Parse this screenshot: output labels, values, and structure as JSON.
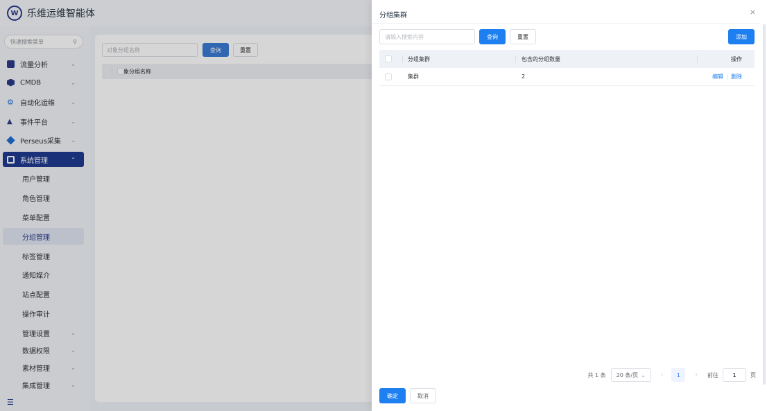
{
  "app": {
    "title": "乐维运维智能体",
    "logo_text": "W"
  },
  "sidebar": {
    "search_placeholder": "快速搜索菜单",
    "items": [
      {
        "label": "流量分析",
        "icon": "chart-icon",
        "color": "#2a3a8a"
      },
      {
        "label": "CMDB",
        "icon": "cube-icon",
        "color": "#2a3a8a"
      },
      {
        "label": "自动化运维",
        "icon": "gear-icon",
        "color": "#1f6fd0"
      },
      {
        "label": "事件平台",
        "icon": "bell-icon",
        "color": "#2a3a8a"
      },
      {
        "label": "Perseus采集",
        "icon": "diamond-icon",
        "color": "#1f6fd0"
      },
      {
        "label": "系统管理",
        "icon": "settings-icon",
        "color": "#ffffff"
      }
    ],
    "subitems": [
      "用户管理",
      "角色管理",
      "菜单配置",
      "分组管理",
      "标签管理",
      "通知媒介",
      "站点配置",
      "操作审计"
    ],
    "expandable_subitems": [
      "管理设置",
      "数据权限",
      "素材管理",
      "集成管理"
    ],
    "collapse_icon": "menu-fold-icon"
  },
  "background": {
    "search_placeholder": "对象分组名称",
    "query_label": "查询",
    "reset_label": "重置",
    "table_header": "对象分组名称"
  },
  "drawer": {
    "title": "分组集群",
    "close": "×",
    "search_placeholder": "请输入搜索内容",
    "query_label": "查询",
    "reset_label": "重置",
    "add_label": "添加",
    "columns": [
      "分组集群",
      "包含的分组数量",
      "操作"
    ],
    "rows": [
      {
        "name": "集群",
        "count": "2",
        "edit": "编辑",
        "delete": "删除"
      }
    ],
    "pagination": {
      "total": "共 1 条",
      "page_size": "20 条/页",
      "current_page": "1",
      "goto_label": "前往",
      "goto_value": "1",
      "page_suffix": "页"
    },
    "ok_label": "确定",
    "cancel_label": "取消"
  },
  "colors": {
    "primary": "#1e7ff0",
    "nav_active": "#1f3a8f"
  }
}
